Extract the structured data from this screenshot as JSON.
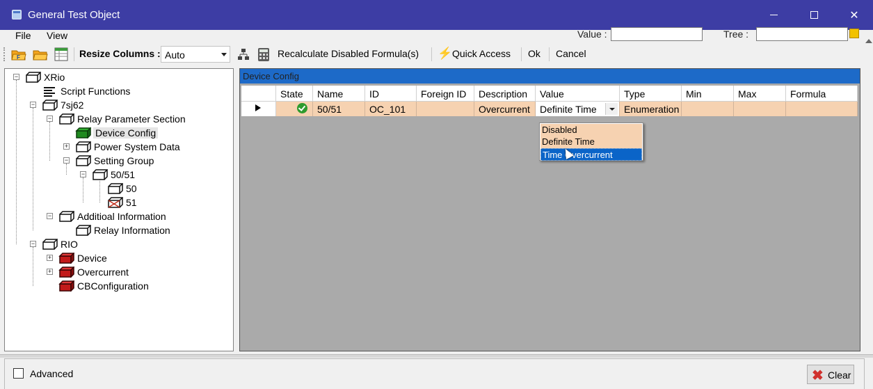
{
  "window": {
    "title": "General Test Object",
    "minimize_icon": "minimize-icon",
    "maximize_icon": "maximize-icon",
    "close_glyph": "✕"
  },
  "menu": {
    "file": "File",
    "view": "View",
    "value_label": "Value :",
    "tree_label": "Tree :",
    "value_field": "",
    "tree_field": ""
  },
  "toolbar": {
    "resize_columns_label": "Resize Columns :",
    "resize_columns_value": "Auto",
    "recalc_label": "Recalculate Disabled Formula(s)",
    "quick_access_label": "Quick Access",
    "ok_label": "Ok",
    "cancel_label": "Cancel",
    "bolt_glyph": "⚡"
  },
  "tree": {
    "items": [
      {
        "label": "XRio"
      },
      {
        "label": "Script Functions"
      },
      {
        "label": "7sj62"
      },
      {
        "label": "Relay Parameter Section"
      },
      {
        "label": "Device Config"
      },
      {
        "label": "Power System Data"
      },
      {
        "label": "Setting Group"
      },
      {
        "label": "50/51"
      },
      {
        "label": "50"
      },
      {
        "label": "51"
      },
      {
        "label": "Additioal Information"
      },
      {
        "label": "Relay Information"
      },
      {
        "label": "RIO"
      },
      {
        "label": "Device"
      },
      {
        "label": "Overcurrent"
      },
      {
        "label": "CBConfiguration"
      }
    ]
  },
  "device_config": {
    "header": "Device Config",
    "columns": [
      "State",
      "Name",
      "ID",
      "Foreign ID",
      "Description",
      "Value",
      "Type",
      "Min",
      "Max",
      "Formula"
    ],
    "row": {
      "name": "50/51",
      "id": "OC_101",
      "foreign_id": "",
      "description": "Overcurrent",
      "value": "Definite Time",
      "type": "Enumeration",
      "min": "",
      "max": "",
      "formula": ""
    },
    "dropdown_options": [
      "Disabled",
      "Definite Time",
      "Time Overcurrent"
    ],
    "highlighted_option": "Time Overcurrent"
  },
  "bottom": {
    "advanced_label": "Advanced",
    "clear_label": "Clear",
    "clear_glyph": "✖"
  },
  "colors": {
    "titlebar": "#3d3da4",
    "panel_header": "#1d6ac8",
    "row_highlight": "#f6d2b1",
    "selection": "#0a64c8"
  }
}
